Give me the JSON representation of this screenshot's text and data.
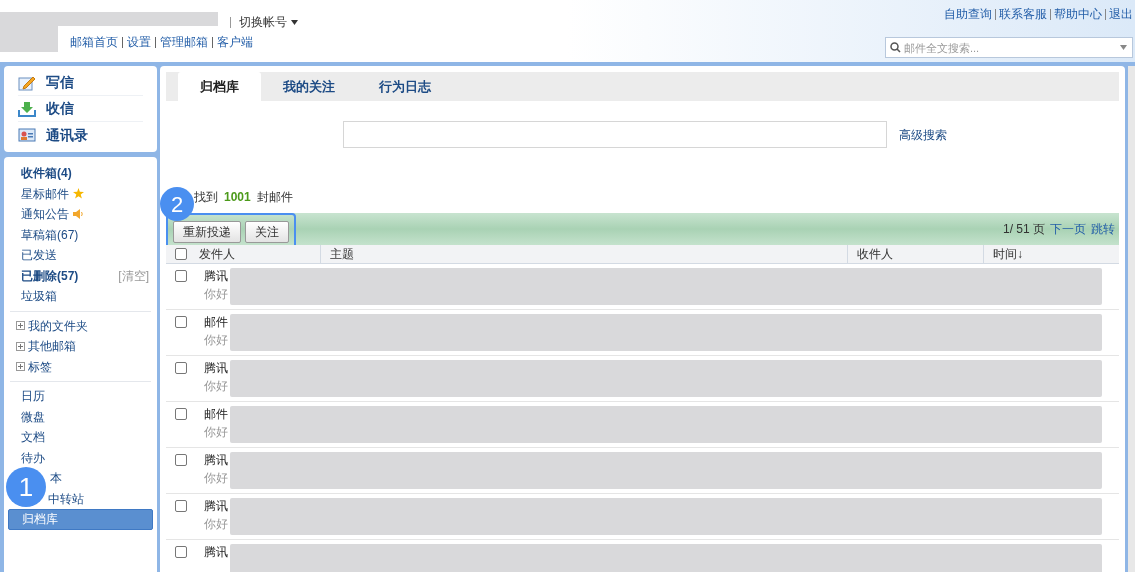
{
  "header": {
    "switch_account": "切换帐号",
    "links": [
      "邮箱首页",
      "设置",
      "管理邮箱",
      "客户端"
    ],
    "top_links": [
      "自助查询",
      "联系客服",
      "帮助中心",
      "退出"
    ],
    "search": {
      "placeholder": "邮件全文搜索..."
    }
  },
  "quick_actions": [
    {
      "kind": "compose",
      "label": "写信"
    },
    {
      "kind": "receive",
      "label": "收信"
    },
    {
      "kind": "contacts",
      "label": "通讯录"
    }
  ],
  "folders": [
    {
      "label": "收件箱(4)",
      "bold": true,
      "kind": "plain"
    },
    {
      "label": "星标邮件",
      "bold": false,
      "kind": "star"
    },
    {
      "label": "通知公告",
      "bold": false,
      "kind": "notice"
    },
    {
      "label": "草稿箱(67)",
      "bold": false,
      "kind": "plain"
    },
    {
      "label": "已发送",
      "bold": false,
      "kind": "plain"
    },
    {
      "label": "已删除(57)",
      "bold": true,
      "kind": "plain",
      "action": "[清空]"
    },
    {
      "label": "垃圾箱",
      "bold": false,
      "kind": "plain"
    }
  ],
  "groups": [
    {
      "label": "我的文件夹",
      "expanded": false
    },
    {
      "label": "其他邮箱",
      "expanded": false
    },
    {
      "label": "标签",
      "expanded": false
    }
  ],
  "apps": [
    {
      "label": "日历",
      "selected": false
    },
    {
      "label": "微盘",
      "selected": false
    },
    {
      "label": "文档",
      "selected": false
    },
    {
      "label": "待办",
      "selected": false
    },
    {
      "label": "本",
      "selected": false
    },
    {
      "label": "中转站",
      "selected": false
    },
    {
      "label": "归档库",
      "selected": true
    }
  ],
  "tabs": [
    {
      "label": "归档库",
      "selected": true
    },
    {
      "label": "我的关注",
      "selected": false
    },
    {
      "label": "行为日志",
      "selected": false
    }
  ],
  "advanced_search": "高级搜索",
  "result": {
    "prefix": "找到",
    "count": "1001",
    "suffix": "封邮件"
  },
  "toolbar": {
    "buttons": [
      "重新投递",
      "关注"
    ],
    "page": "1/ 51 页",
    "next": "下一页",
    "jump": "跳转"
  },
  "table": {
    "columns": [
      "发件人",
      "主题",
      "收件人",
      "时间↓"
    ],
    "select_all": false,
    "rows": [
      {
        "sender": "腾讯",
        "preview": "你好",
        "checked": false
      },
      {
        "sender": "邮件",
        "preview": "你好",
        "checked": false
      },
      {
        "sender": "腾讯",
        "preview": "你好",
        "checked": false
      },
      {
        "sender": "邮件",
        "preview": "你好",
        "checked": false
      },
      {
        "sender": "腾讯",
        "preview": "你好",
        "checked": false
      },
      {
        "sender": "腾讯",
        "preview": "你好",
        "checked": false
      },
      {
        "sender": "腾讯",
        "checked": false
      }
    ]
  },
  "callouts": [
    "1",
    "2"
  ]
}
